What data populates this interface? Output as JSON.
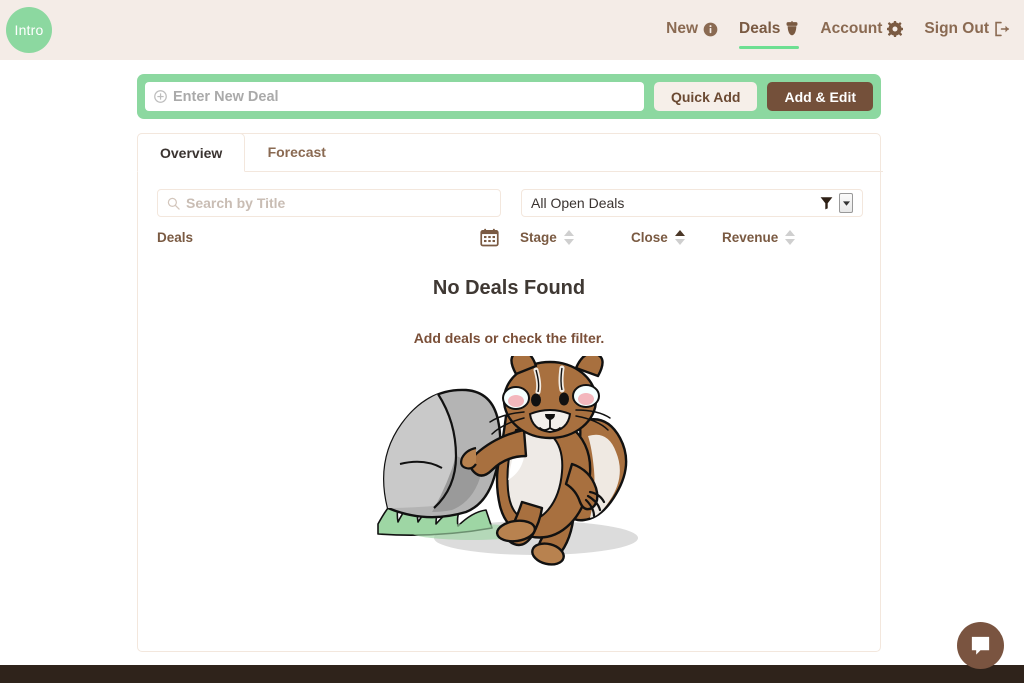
{
  "header": {
    "intro_badge": "Intro",
    "nav": [
      {
        "label": "New",
        "icon": "info-circle-icon",
        "active": false
      },
      {
        "label": "Deals",
        "icon": "acorn-icon",
        "active": true
      },
      {
        "label": "Account",
        "icon": "gear-icon",
        "active": false
      },
      {
        "label": "Sign Out",
        "icon": "sign-out-icon",
        "active": false
      }
    ]
  },
  "newdeal": {
    "placeholder": "Enter New Deal",
    "value": "",
    "add_icon": "plus-circle-icon",
    "quick_add_label": "Quick Add",
    "add_edit_label": "Add & Edit"
  },
  "tabs": [
    {
      "label": "Overview",
      "active": true
    },
    {
      "label": "Forecast",
      "active": false
    }
  ],
  "filters": {
    "search_placeholder": "Search by Title",
    "search_value": "",
    "search_icon": "search-icon",
    "filter_value": "All Open Deals",
    "filter_icon": "funnel-icon",
    "caret_icon": "chevron-down-icon"
  },
  "table": {
    "columns": [
      {
        "label": "Deals",
        "sortable": false,
        "sort": "none"
      },
      {
        "label": "Stage",
        "sortable": true,
        "sort": "none"
      },
      {
        "label": "Close",
        "sortable": true,
        "sort": "asc"
      },
      {
        "label": "Revenue",
        "sortable": true,
        "sort": "none"
      }
    ],
    "calendar_icon": "calendar-icon",
    "rows": []
  },
  "empty_state": {
    "title": "No Deals Found",
    "subtitle": "Add deals or check the filter.",
    "illustration": "squirrel-leaning-on-rock-illustration"
  },
  "chat": {
    "icon": "chat-bubble-icon"
  },
  "colors": {
    "header_bg": "#f4ece7",
    "accent_green": "#8cd8a0",
    "brand_brown": "#74503a",
    "footer_brown": "#2f231b",
    "text_brown": "#8a6a52"
  }
}
